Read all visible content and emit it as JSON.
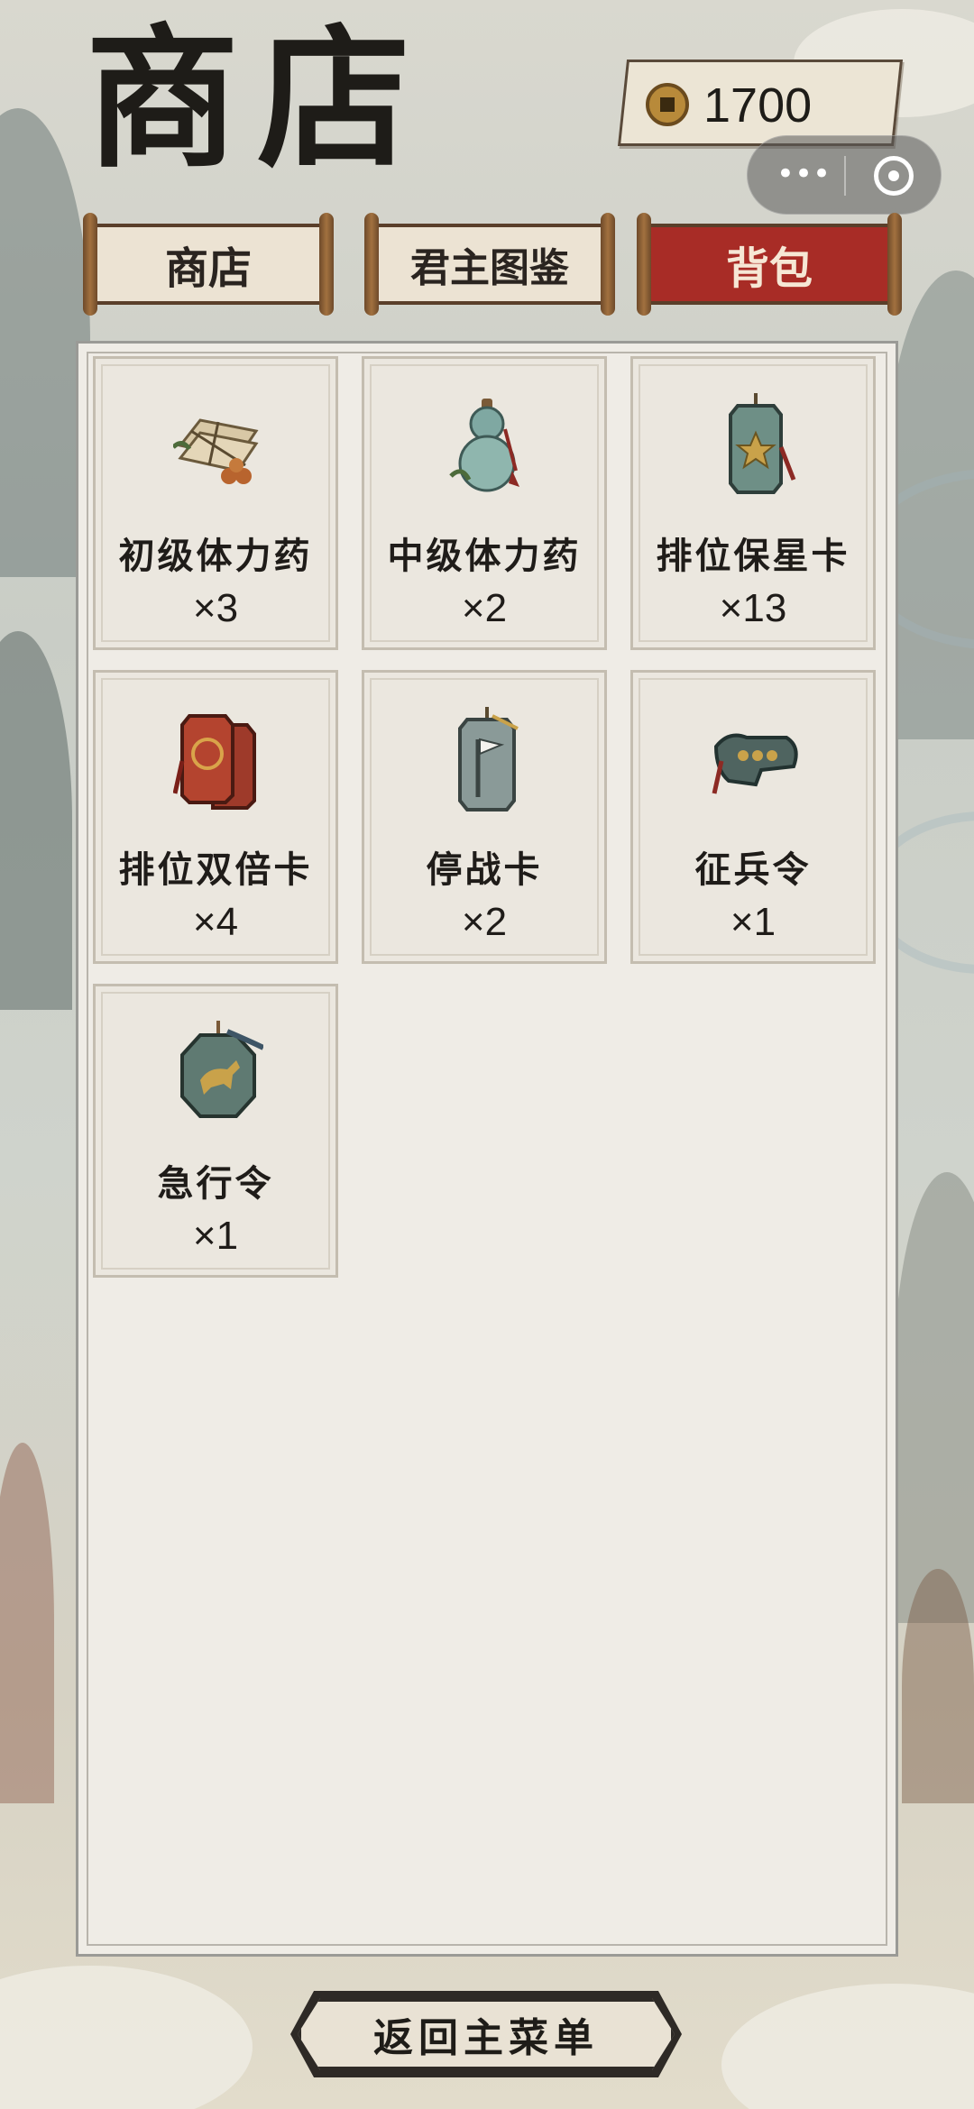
{
  "header": {
    "title": "商店",
    "currency": {
      "icon": "coin-icon",
      "value": "1700"
    }
  },
  "system_capsule": {
    "more_icon": "•••",
    "close_icon": "target-icon"
  },
  "tabs": [
    {
      "label": "商店",
      "active": false
    },
    {
      "label": "君主图鉴",
      "active": false
    },
    {
      "label": "背包",
      "active": true
    }
  ],
  "inventory": {
    "items": [
      {
        "name": "初级体力药",
        "count": "×3",
        "icon": "herb-bundle-icon"
      },
      {
        "name": "中级体力药",
        "count": "×2",
        "icon": "gourd-icon"
      },
      {
        "name": "排位保星卡",
        "count": "×13",
        "icon": "star-tablet-icon"
      },
      {
        "name": "排位双倍卡",
        "count": "×4",
        "icon": "double-tablet-icon"
      },
      {
        "name": "停战卡",
        "count": "×2",
        "icon": "white-flag-tablet-icon"
      },
      {
        "name": "征兵令",
        "count": "×1",
        "icon": "soldier-token-icon"
      },
      {
        "name": "急行令",
        "count": "×1",
        "icon": "horse-token-icon"
      }
    ]
  },
  "footer": {
    "back_label": "返回主菜单"
  },
  "colors": {
    "active_tab": "#a82c26",
    "panel": "#efece6",
    "text": "#1f1c19"
  }
}
